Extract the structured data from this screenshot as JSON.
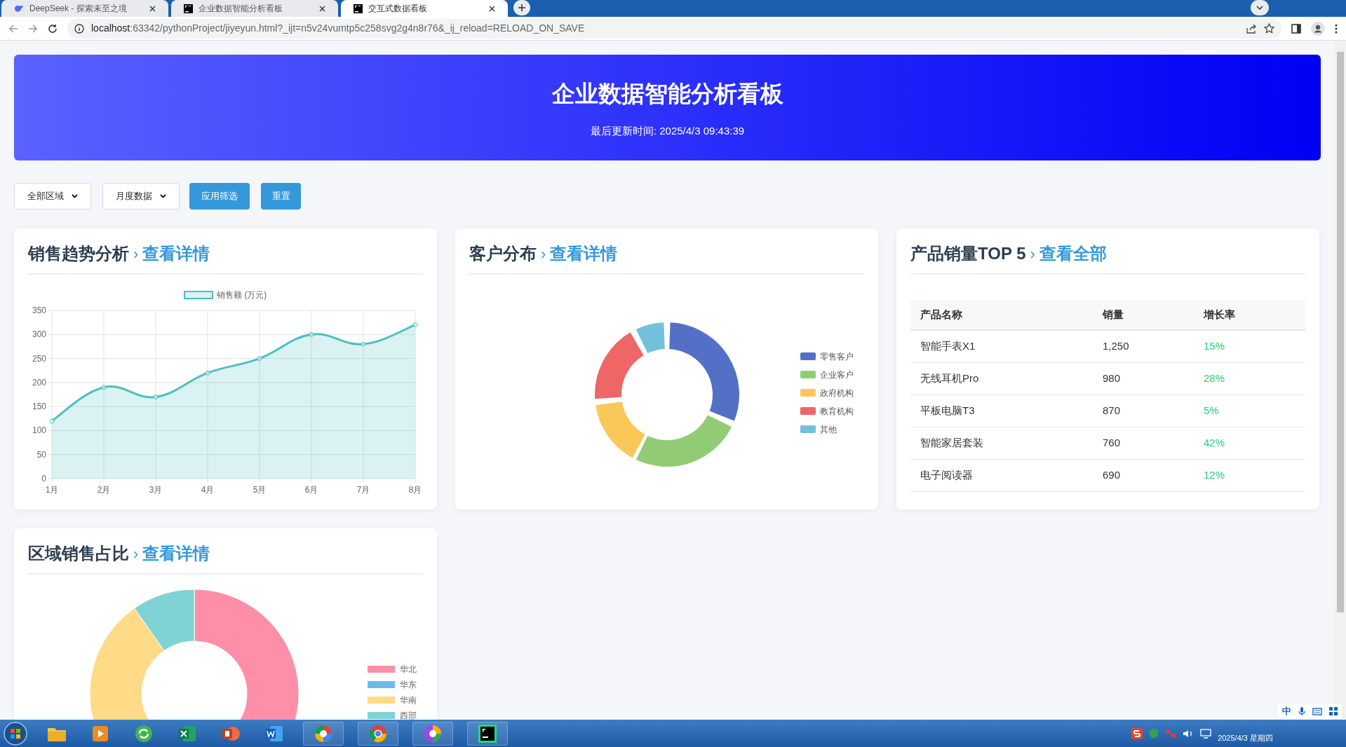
{
  "browser": {
    "tabs": [
      {
        "title": "DeepSeek - 探索未至之境",
        "kind": "whale",
        "selected": false
      },
      {
        "title": "企业数据智能分析看板",
        "kind": "pc",
        "selected": false
      },
      {
        "title": "交互式数据看板",
        "kind": "pc",
        "selected": true
      }
    ],
    "address": {
      "host": "localhost",
      "path": ":63342/pythonProject/jiyeyun.html?_ijt=n5v24vumtp5c258svg2g4n8r76&_ij_reload=RELOAD_ON_SAVE"
    }
  },
  "header": {
    "title": "企业数据智能分析看板",
    "updated": "最后更新时间: 2025/4/3 09:43:39"
  },
  "filters": {
    "selects": [
      "全部区域",
      "月度数据"
    ],
    "buttons": [
      "应用筛选",
      "重置"
    ]
  },
  "cards": [
    {
      "kind": "line",
      "title": "销售趋势分析",
      "separator": "›",
      "link": "查看详情",
      "chart_data": {
        "type": "area",
        "categories": [
          "1月",
          "2月",
          "3月",
          "4月",
          "5月",
          "6月",
          "7月",
          "8月"
        ],
        "series": [
          {
            "name": "销售额 (万元)",
            "color": "#4bc0c0",
            "values": [
              120,
              190,
              170,
              220,
              250,
              300,
              280,
              320
            ]
          }
        ],
        "ylim": [
          0,
          350
        ],
        "grid": true,
        "yticks": [
          0,
          50,
          100,
          150,
          200,
          250,
          300,
          350
        ]
      }
    },
    {
      "kind": "donut",
      "title": "客户分布",
      "separator": "›",
      "link": "查看详情",
      "legend": [
        {
          "label": "零售客户",
          "color": "#5470c6"
        },
        {
          "label": "企业客户",
          "color": "#91cc75"
        },
        {
          "label": "政府机构",
          "color": "#fac858"
        },
        {
          "label": "教育机构",
          "color": "#ee6666"
        },
        {
          "label": "其他",
          "color": "#73c0de"
        }
      ]
    },
    {
      "kind": "table",
      "title": "产品销量TOP 5",
      "separator": "›",
      "link": "查看全部",
      "columns": [
        "产品名称",
        "销量",
        "增长率"
      ],
      "rows": [
        [
          "智能手表X1",
          "1,250",
          "15%"
        ],
        [
          "无线耳机Pro",
          "980",
          "28%"
        ],
        [
          "平板电脑T3",
          "870",
          "5%"
        ],
        [
          "智能家居套装",
          "760",
          "42%"
        ],
        [
          "电子阅读器",
          "690",
          "12%"
        ]
      ]
    },
    {
      "kind": "region",
      "title": "区域销售占比",
      "separator": "›",
      "link": "查看详情",
      "legend": [
        {
          "label": "华北",
          "color": "#ff8fa8"
        },
        {
          "label": "华东",
          "color": "#6cb9ea"
        },
        {
          "label": "华南",
          "color": "#ffdb87"
        },
        {
          "label": "西部",
          "color": "#7fd3d4"
        }
      ]
    }
  ],
  "taskbar": {
    "ime": "中",
    "date": "2025/4/3 星期四"
  }
}
